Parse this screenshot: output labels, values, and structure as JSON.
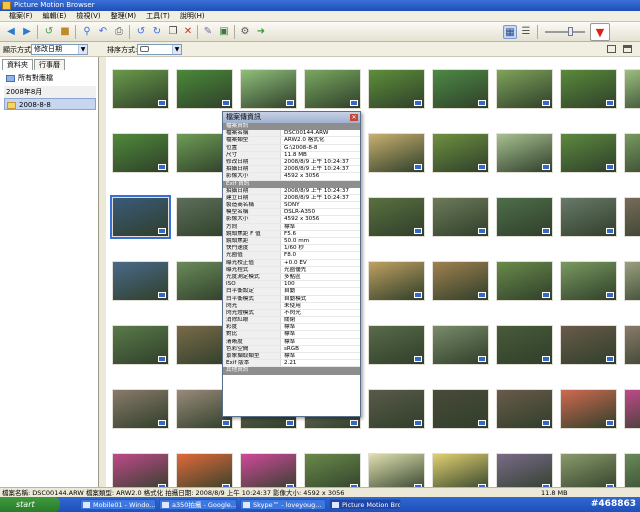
{
  "window": {
    "title": "Picture Motion Browser"
  },
  "menu": [
    "檔案(F)",
    "編輯(E)",
    "檢視(V)",
    "整理(M)",
    "工具(T)",
    "說明(H)"
  ],
  "optbar": {
    "display_label": "顯示方式:",
    "display_value": "修改日期",
    "sort_label": "排序方式:",
    "sort_value": ""
  },
  "left": {
    "tabs": [
      "資料夾",
      "行事曆"
    ],
    "tree": [
      {
        "label": "所有對應檔",
        "selected": false
      },
      {
        "label": "2008年8月",
        "selected": false
      },
      {
        "label": "2008-8-8",
        "selected": true
      }
    ]
  },
  "properties": {
    "title": "檔案傳資訊",
    "sections": [
      {
        "name": "檔案資訊",
        "rows": [
          [
            "檔案名稱",
            "DSC00144.ARW"
          ],
          [
            "檔案類型",
            "ARW2.0 格式化"
          ],
          [
            "位置",
            "G:\\2008-8-8"
          ],
          [
            "尺寸",
            "11.8 MB"
          ],
          [
            "修改日期",
            "2008/8/9 上午 10:24:37"
          ],
          [
            "拍攝日期",
            "2008/8/9 上午 10:24:37"
          ],
          [
            "影像大小",
            "4592 x 3056"
          ]
        ]
      },
      {
        "name": "Exif 資訊",
        "rows": [
          [
            "拍攝日期",
            "2008/8/9 上午 10:24:37"
          ],
          [
            "建立日期",
            "2008/8/9 上午 10:24:37"
          ],
          [
            "製造商名稱",
            "SONY"
          ],
          [
            "模型名稱",
            "DSLR-A350"
          ],
          [
            "影像大小",
            "4592 x 3056"
          ],
          [
            "方向",
            "標準"
          ],
          [
            "鏡頭焦距 F 值",
            "F5.6"
          ],
          [
            "鏡頭焦距",
            "50.0 mm"
          ],
          [
            "快門速度",
            "1/60 秒"
          ],
          [
            "光圈值",
            "F8.0"
          ],
          [
            "曝光校正值",
            "+0.0 EV"
          ],
          [
            "曝光程式",
            "光圈優先"
          ],
          [
            "光度測定模式",
            "多點區"
          ],
          [
            "ISO",
            "100"
          ],
          [
            "白平衡設定",
            "自動"
          ],
          [
            "白平衡模式",
            "自動模式"
          ],
          [
            "閃光",
            "未使用"
          ],
          [
            "閃光燈模式",
            "不閃光"
          ],
          [
            "消除紅眼",
            "關閉"
          ],
          [
            "彩度",
            "標準"
          ],
          [
            "對比",
            "標準"
          ],
          [
            "清晰度",
            "標準"
          ],
          [
            "色彩空間",
            "sRGB"
          ],
          [
            "景象擷取類型",
            "標準"
          ],
          [
            "Exif 版本",
            "2.21"
          ]
        ]
      },
      {
        "name": "其他資訊",
        "rows": []
      }
    ]
  },
  "status": {
    "text": "檔案名稱: DSC00144.ARW   檔案類型: ARW2.0 格式化   拍攝日期: 2008/8/9 上午 10:24:37   影像大小: 4592 x 3056",
    "size": "11.8 MB"
  },
  "taskbar": {
    "start": "start",
    "tasks": [
      "Mobile01 - Windo...",
      "a350拍攝 - Google...",
      "Skype™ - loveyoug...",
      "Picture Motion Bro..."
    ],
    "watermark": "#468863"
  },
  "thumb_colors": [
    [
      "#6a9a4a",
      "#4a8a3a",
      "#8fc07a",
      "#7aa860",
      "#5e8f3a",
      "#4d8a45",
      "#7fa35a",
      "#5a8a3a",
      "#9bbf80",
      "#6f9f55"
    ],
    [
      "#4f8a3a",
      "#6e9c55",
      "#7a8f50",
      "#8aa66a",
      "#c8b070",
      "#6e9040",
      "#a7c090",
      "#5c8a40",
      "#789a60",
      "#4e7e38"
    ],
    [
      "#3a5a7a",
      "#5d6f5a",
      "#8a7a5a",
      "#6a6a6a",
      "#5a7040",
      "#6e7a5a",
      "#4e6e4a",
      "#6a7a6a",
      "#7a6a5a",
      "#8a8a7a"
    ],
    [
      "#4a6a8a",
      "#6a8a5a",
      "#7a5a4a",
      "#8a7a4a",
      "#c0a060",
      "#a08050",
      "#6a8a4a",
      "#7a9a60",
      "#9aa080",
      "#6a8060"
    ],
    [
      "#5a7a4a",
      "#7a6a4a",
      "#8a9a7a",
      "#6a7a5a",
      "#5a6a4a",
      "#7a8a6a",
      "#4a5a3a",
      "#6a5a4a",
      "#8a7a6a",
      "#5a4a3a"
    ],
    [
      "#8a7a6a",
      "#9a8a7a",
      "#6a6a5a",
      "#7a7a6a",
      "#5a5a4a",
      "#4a4a3a",
      "#6a5a4a",
      "#d06a50",
      "#c04a8a",
      "#6a8a4a"
    ],
    [
      "#c04a8a",
      "#e06a3a",
      "#d04a9a",
      "#6a8a4a",
      "#e0e0b0",
      "#e0d070",
      "#7a6a8a",
      "#8a9a6a",
      "#6a8a5a",
      "#7a9a6a"
    ]
  ]
}
